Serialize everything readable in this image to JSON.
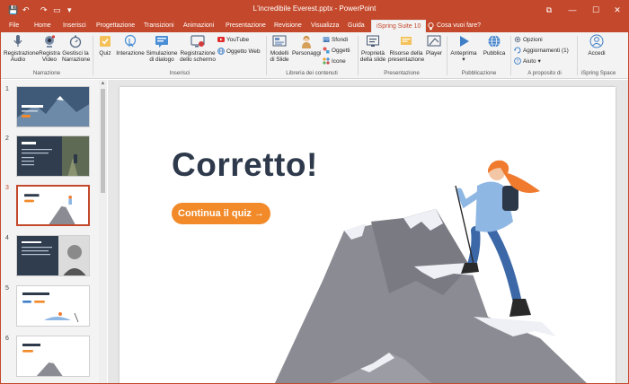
{
  "window": {
    "title": "L'incredibile Everest.pptx  -  PowerPoint",
    "controls": {
      "ribbon_display": "⧉",
      "minimize": "—",
      "maximize": "☐",
      "close": "✕"
    }
  },
  "quick_access": {
    "save": "💾",
    "undo": "↶",
    "redo": "↷",
    "start": "▭",
    "customize": "▾"
  },
  "tabs": [
    {
      "label": "File"
    },
    {
      "label": "Home"
    },
    {
      "label": "Inserisci"
    },
    {
      "label": "Progettazione"
    },
    {
      "label": "Transizioni"
    },
    {
      "label": "Animazioni"
    },
    {
      "label": "Presentazione"
    },
    {
      "label": "Revisione"
    },
    {
      "label": "Visualizza"
    },
    {
      "label": "Guida"
    },
    {
      "label": "iSpring Suite 10"
    }
  ],
  "tell_me": "Cosa vuoi fare?",
  "ribbon": {
    "narrazione": {
      "group": "Narrazione",
      "rec_audio": "Registrazione\nAudio",
      "rec_video": "Registra\nVideo",
      "manage": "Gestisci la\nNarrazione"
    },
    "inserisci": {
      "group": "Inserisci",
      "quiz": "Quiz",
      "interaction": "Interazione",
      "dialog_sim": "Simulazione\ndi dialogo",
      "screen_rec": "Registrazione\ndello schermo",
      "youtube": "YouTube",
      "web_object": "Oggetto Web"
    },
    "libreria": {
      "group": "Libreria dei contenuti",
      "slide_templates": "Modelli\ndi Slide",
      "characters": "Personaggi",
      "backgrounds": "Sfondi",
      "objects": "Oggetti",
      "icons": "Icone"
    },
    "presentazione": {
      "group": "Presentazione",
      "slide_props": "Proprietà\ndella slide",
      "resources": "Risorse della\npresentazione",
      "player": "Player"
    },
    "pubblicazione": {
      "group": "Pubblicazione",
      "preview": "Anteprima",
      "publish": "Pubblica"
    },
    "about": {
      "group": "A proposito di",
      "options": "Opzioni",
      "updates": "Aggiornamenti  (1)",
      "help": "Aiuto"
    },
    "space": {
      "group": "iSpring Space",
      "login": "Accedi"
    }
  },
  "slides": [
    {
      "num": "1",
      "caption": "L'incredibile Everest"
    },
    {
      "num": "2",
      "caption": ""
    },
    {
      "num": "3",
      "caption": "Corretto!"
    },
    {
      "num": "4",
      "caption": ""
    },
    {
      "num": "5",
      "caption": "Ooops, è sbagliato ..."
    },
    {
      "num": "6",
      "caption": "Corretto!"
    }
  ],
  "slide": {
    "title": "Corretto!",
    "button": "Continua il quiz →"
  },
  "colors": {
    "accent": "#c4492c",
    "cta": "#f28a2a",
    "title": "#2e3a4b",
    "shirt": "#8fb7e3",
    "hair": "#f07a2e",
    "mountain": "#8b8b93"
  }
}
